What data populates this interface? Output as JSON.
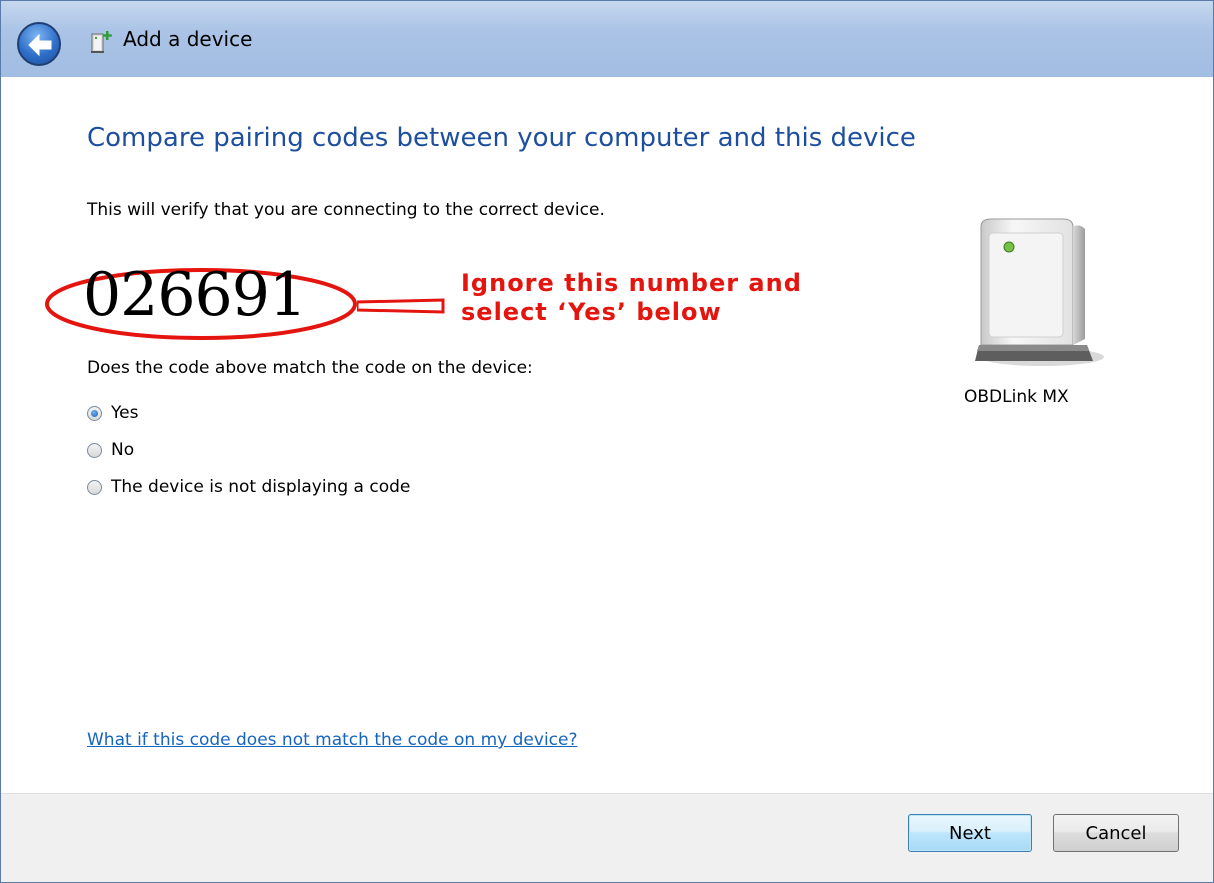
{
  "window": {
    "title": "Add a device"
  },
  "titlebar": {
    "back_icon": "back-arrow-icon",
    "device_icon": "add-device-icon"
  },
  "content": {
    "heading": "Compare pairing codes between your computer and this device",
    "subtitle": "This will verify that you are connecting to the correct device.",
    "pairing_code": "026691",
    "annotation": {
      "line1": "Ignore this number and",
      "line2": "select ‘Yes’ below",
      "color": "#e4140e"
    },
    "question": "Does the code above match the code on the device:",
    "options": [
      {
        "label": "Yes",
        "selected": true
      },
      {
        "label": "No",
        "selected": false
      },
      {
        "label": "The device is not displaying a code",
        "selected": false
      }
    ],
    "device": {
      "name": "OBDLink MX",
      "icon": "computer-tower-icon"
    },
    "help_link": "What if this code does not match the code on my device?"
  },
  "footer": {
    "next_label": "Next",
    "cancel_label": "Cancel"
  },
  "colors": {
    "heading": "#1e4f9e",
    "link": "#1565c0",
    "annotation": "#e4140e"
  }
}
